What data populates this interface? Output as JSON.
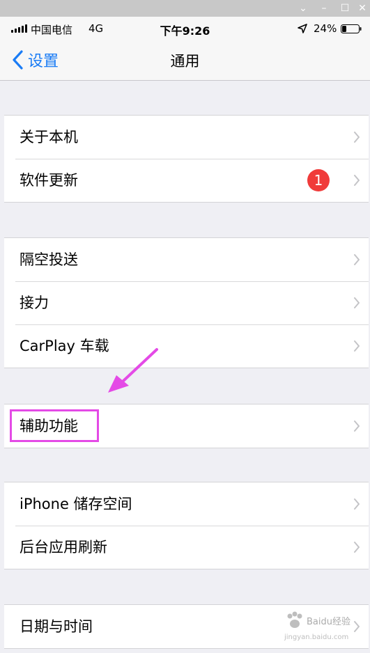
{
  "window": {
    "minimize": "⌄",
    "restore": "–",
    "maximize": "☐",
    "close": "✕"
  },
  "status_bar": {
    "carrier": "中国电信",
    "network": "4G",
    "time": "下午9:26",
    "battery": "24%"
  },
  "nav": {
    "back_label": "设置",
    "title": "通用"
  },
  "groups": [
    {
      "items": [
        {
          "label": "关于本机"
        },
        {
          "label": "软件更新",
          "badge": "1"
        }
      ]
    },
    {
      "items": [
        {
          "label": "隔空投送"
        },
        {
          "label": "接力"
        },
        {
          "label": "CarPlay 车载"
        }
      ]
    },
    {
      "items": [
        {
          "label": "辅助功能",
          "highlighted": true
        }
      ]
    },
    {
      "items": [
        {
          "label": "iPhone 储存空间"
        },
        {
          "label": "后台应用刷新"
        }
      ]
    },
    {
      "items": [
        {
          "label": "日期与时间"
        }
      ]
    }
  ],
  "colors": {
    "accent": "#1a7cf5",
    "badge": "#f03b3a",
    "annotation": "#e44ae6",
    "background": "#efeff4"
  },
  "watermark": {
    "text": "Baidu经验",
    "subtext": "jingyan.baidu.com"
  }
}
